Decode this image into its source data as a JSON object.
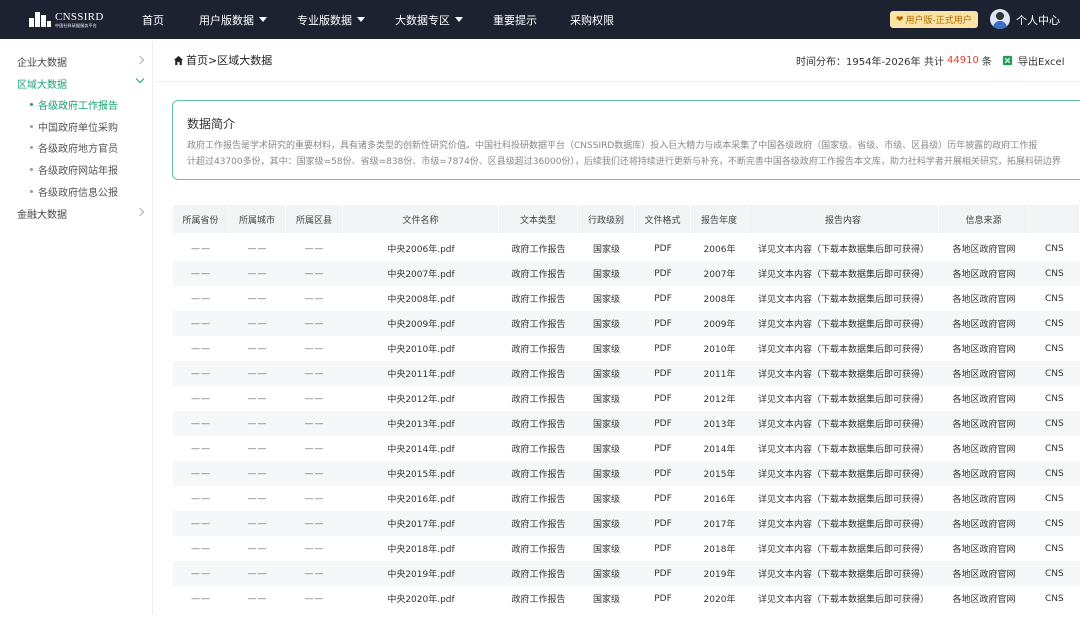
{
  "topbar": {
    "logo_text": "CNSSIRD",
    "logo_subtext": "中国社科研据服务平台",
    "nav": [
      {
        "label": "首页",
        "has_caret": false
      },
      {
        "label": "用户版数据",
        "has_caret": true
      },
      {
        "label": "专业版数据",
        "has_caret": true
      },
      {
        "label": "大数据专区",
        "has_caret": true
      },
      {
        "label": "重要提示",
        "has_caret": false
      },
      {
        "label": "采购权限",
        "has_caret": false
      }
    ],
    "user_badge": "用户版-正式用户",
    "profile_label": "个人中心"
  },
  "sidebar": {
    "items": [
      {
        "label": "企业大数据",
        "expanded": false
      },
      {
        "label": "区域大数据",
        "expanded": true
      },
      {
        "label": "金融大数据",
        "expanded": false
      }
    ],
    "subitems": [
      {
        "label": "各级政府工作报告",
        "active": true
      },
      {
        "label": "中国政府单位采购",
        "active": false
      },
      {
        "label": "各级政府地方官员",
        "active": false
      },
      {
        "label": "各级政府网站年报",
        "active": false
      },
      {
        "label": "各级政府信息公报",
        "active": false
      }
    ]
  },
  "header": {
    "breadcrumb": "首页>区域大数据",
    "time_range": "时间分布：1954年-2026年",
    "count_prefix": "共计",
    "count_value": "44910",
    "count_suffix": "条",
    "export_label": "导出Excel"
  },
  "intro": {
    "title": "数据简介",
    "line1": "政府工作报告是学术研究的重要材料，具有诸多类型的创新性研究价值。中国社科投研数据平台（CNSSIRD数据库）投入巨大精力与成本采集了中国各级政府（国家级、省级、市级、区县级）历年披露的政府工作报",
    "line2": "计超过43700多份，其中：国家级=58份、省级=838份、市级=7874份、区县级超过36000份），后续我们还将持续进行更新与补充，不断完善中国各级政府工作报告本文库，助力社科学者开展相关研究，拓展科研边界"
  },
  "table": {
    "columns": [
      "所属省份",
      "所属城市",
      "所属区县",
      "文件名称",
      "文本类型",
      "行政级别",
      "文件格式",
      "报告年度",
      "报告内容",
      "信息来源",
      ""
    ],
    "rows": [
      [
        "——",
        "——",
        "——",
        "中央2006年.pdf",
        "政府工作报告",
        "国家级",
        "PDF",
        "2006年",
        "详见文本内容（下载本数据集后即可获得）",
        "各地区政府官网",
        "CNS"
      ],
      [
        "——",
        "——",
        "——",
        "中央2007年.pdf",
        "政府工作报告",
        "国家级",
        "PDF",
        "2007年",
        "详见文本内容（下载本数据集后即可获得）",
        "各地区政府官网",
        "CNS"
      ],
      [
        "——",
        "——",
        "——",
        "中央2008年.pdf",
        "政府工作报告",
        "国家级",
        "PDF",
        "2008年",
        "详见文本内容（下载本数据集后即可获得）",
        "各地区政府官网",
        "CNS"
      ],
      [
        "——",
        "——",
        "——",
        "中央2009年.pdf",
        "政府工作报告",
        "国家级",
        "PDF",
        "2009年",
        "详见文本内容（下载本数据集后即可获得）",
        "各地区政府官网",
        "CNS"
      ],
      [
        "——",
        "——",
        "——",
        "中央2010年.pdf",
        "政府工作报告",
        "国家级",
        "PDF",
        "2010年",
        "详见文本内容（下载本数据集后即可获得）",
        "各地区政府官网",
        "CNS"
      ],
      [
        "——",
        "——",
        "——",
        "中央2011年.pdf",
        "政府工作报告",
        "国家级",
        "PDF",
        "2011年",
        "详见文本内容（下载本数据集后即可获得）",
        "各地区政府官网",
        "CNS"
      ],
      [
        "——",
        "——",
        "——",
        "中央2012年.pdf",
        "政府工作报告",
        "国家级",
        "PDF",
        "2012年",
        "详见文本内容（下载本数据集后即可获得）",
        "各地区政府官网",
        "CNS"
      ],
      [
        "——",
        "——",
        "——",
        "中央2013年.pdf",
        "政府工作报告",
        "国家级",
        "PDF",
        "2013年",
        "详见文本内容（下载本数据集后即可获得）",
        "各地区政府官网",
        "CNS"
      ],
      [
        "——",
        "——",
        "——",
        "中央2014年.pdf",
        "政府工作报告",
        "国家级",
        "PDF",
        "2014年",
        "详见文本内容（下载本数据集后即可获得）",
        "各地区政府官网",
        "CNS"
      ],
      [
        "——",
        "——",
        "——",
        "中央2015年.pdf",
        "政府工作报告",
        "国家级",
        "PDF",
        "2015年",
        "详见文本内容（下载本数据集后即可获得）",
        "各地区政府官网",
        "CNS"
      ],
      [
        "——",
        "——",
        "——",
        "中央2016年.pdf",
        "政府工作报告",
        "国家级",
        "PDF",
        "2016年",
        "详见文本内容（下载本数据集后即可获得）",
        "各地区政府官网",
        "CNS"
      ],
      [
        "——",
        "——",
        "——",
        "中央2017年.pdf",
        "政府工作报告",
        "国家级",
        "PDF",
        "2017年",
        "详见文本内容（下载本数据集后即可获得）",
        "各地区政府官网",
        "CNS"
      ],
      [
        "——",
        "——",
        "——",
        "中央2018年.pdf",
        "政府工作报告",
        "国家级",
        "PDF",
        "2018年",
        "详见文本内容（下载本数据集后即可获得）",
        "各地区政府官网",
        "CNS"
      ],
      [
        "——",
        "——",
        "——",
        "中央2019年.pdf",
        "政府工作报告",
        "国家级",
        "PDF",
        "2019年",
        "详见文本内容（下载本数据集后即可获得）",
        "各地区政府官网",
        "CNS"
      ],
      [
        "——",
        "——",
        "——",
        "中央2020年.pdf",
        "政府工作报告",
        "国家级",
        "PDF",
        "2020年",
        "详见文本内容（下载本数据集后即可获得）",
        "各地区政府官网",
        "CNS"
      ]
    ]
  },
  "colors": {
    "topbar_bg": "#1c2230",
    "accent_green": "#1ba271",
    "count_red": "#e23b2e",
    "badge_bg": "#fbe3a6"
  }
}
